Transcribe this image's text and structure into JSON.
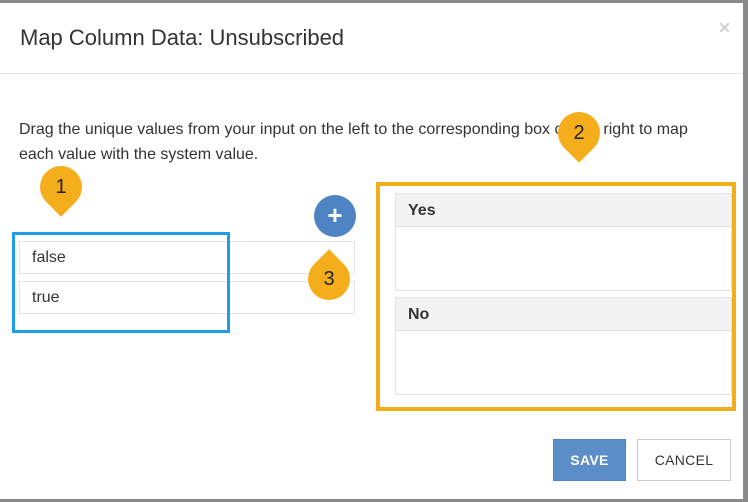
{
  "dialog": {
    "title": "Map Column Data: Unsubscribed",
    "close_glyph": "×",
    "instructions": "Drag the unique values from your input on the left to the corresponding box on the right to map each value with the system value."
  },
  "input_values": [
    "false",
    "true"
  ],
  "add_button": {
    "label": "+"
  },
  "targets": [
    {
      "label": "Yes"
    },
    {
      "label": "No"
    }
  ],
  "callouts": {
    "one": "1",
    "two": "2",
    "three": "3"
  },
  "colors": {
    "callout": "#f4ad1b",
    "blue_highlight": "#1f9de8",
    "orange_highlight": "#f4ad1b",
    "primary": "#5b8dc9"
  },
  "footer": {
    "save_label": "SAVE",
    "cancel_label": "CANCEL"
  }
}
